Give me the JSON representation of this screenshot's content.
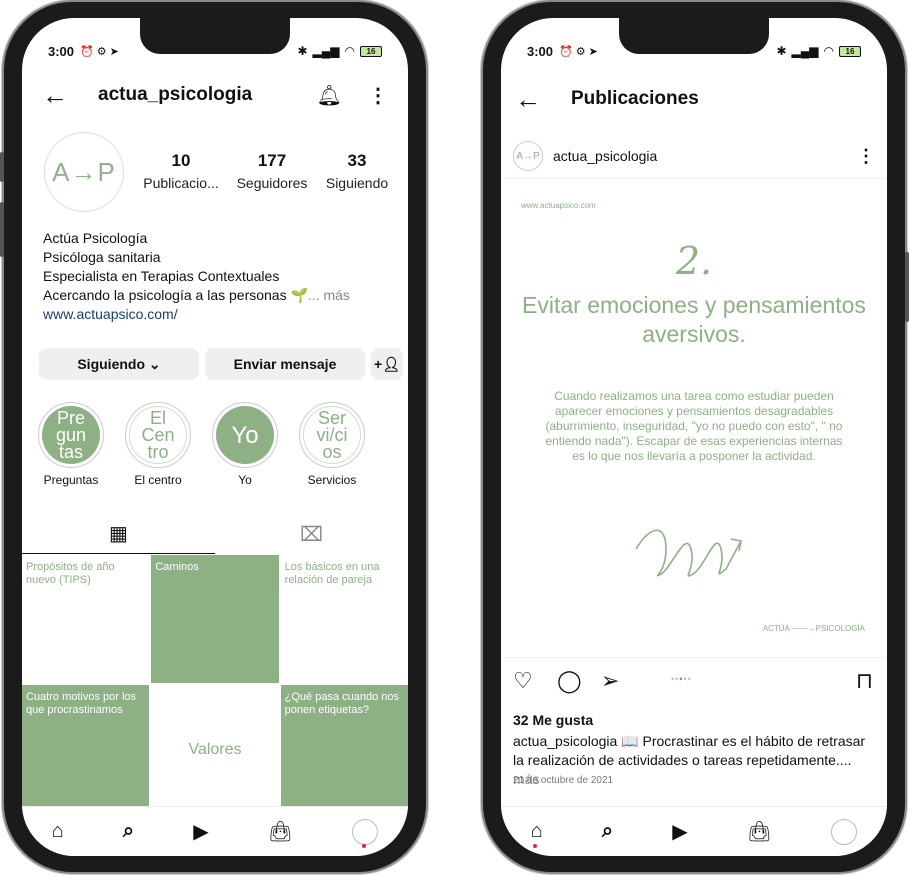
{
  "status": {
    "time": "3:00",
    "battery": "16"
  },
  "profile": {
    "username": "actua_psicologia",
    "avatar_text": "A→P",
    "stats": [
      {
        "value": "10",
        "label": "Publicacio..."
      },
      {
        "value": "177",
        "label": "Seguidores"
      },
      {
        "value": "33",
        "label": "Siguiendo"
      }
    ],
    "name": "Actúa Psicología",
    "bio_lines": [
      "Psicóloga sanitaria",
      "Especialista en Terapias Contextuales",
      "Acercando la psicología a las personas 🌱"
    ],
    "more": "... más",
    "link": "www.actuapsico.com/",
    "buttons": {
      "following": "Siguiendo ⌄",
      "message": "Enviar mensaje"
    },
    "highlights": [
      {
        "label": "Preguntas",
        "cover": "Pre\ngun\ntas"
      },
      {
        "label": "El centro",
        "cover": "El\nCen\ntro"
      },
      {
        "label": "Yo",
        "cover": "Yo"
      },
      {
        "label": "Servicios",
        "cover": "Ser\nvi/ci\nos"
      }
    ],
    "grid": [
      {
        "text": "Propósitos de año nuevo (TIPS)",
        "style": "w"
      },
      {
        "text": "Caminos",
        "style": "g"
      },
      {
        "text": "Los básicos en una relación de pareja",
        "style": "w"
      },
      {
        "text": "Cuatro motivos por los que procrastinamos",
        "style": "g"
      },
      {
        "text": "Valores",
        "style": "w"
      },
      {
        "text": "¿Qué pasa cuando nos ponen etiquetas?",
        "style": "g"
      }
    ]
  },
  "post": {
    "title": "Publicaciones",
    "username": "actua_psicologia",
    "avatar_text": "A→P",
    "url": "www.actuapsico.com",
    "number": "2.",
    "headline": "Evitar emociones y pensamientos aversivos.",
    "body": "Cuando realizamos una tarea como estudiar pueden aparecer emociones y pensamientos desagradables (aburrimiento, inseguridad, \"yo no puedo con esto\", \" no entiendo nada\"). Escapar de esas experiencias internas es lo que nos llevaría a posponer la actividad.",
    "brand": "ACTÚA ——→PSICOLOGÍA",
    "likes": "32 Me gusta",
    "caption_user": "actua_psicologia",
    "caption_text": "📖 Procrastinar es el hábito de retrasar la realización de actividades o tareas repetidamente....",
    "caption_more": "más",
    "date": "21 de octubre de 2021"
  },
  "colors": {
    "accent": "#8db085",
    "link": "#1a3e6e",
    "notification": "#e3243b"
  }
}
